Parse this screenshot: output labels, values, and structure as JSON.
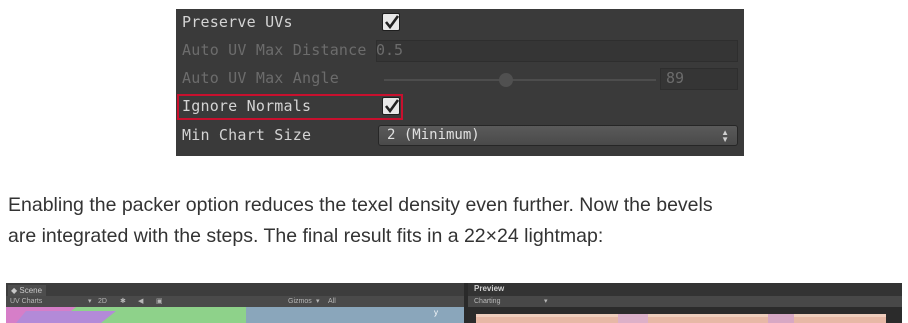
{
  "inspector": {
    "preserve_uvs": {
      "label": "Preserve UVs",
      "checked": true
    },
    "auto_uv_max_distance": {
      "label": "Auto UV Max Distance",
      "value": "0.5"
    },
    "auto_uv_max_angle": {
      "label": "Auto UV Max Angle",
      "value": "89",
      "slider_fraction": 0.45
    },
    "ignore_normals": {
      "label": "Ignore Normals",
      "checked": true
    },
    "min_chart_size": {
      "label": "Min Chart Size",
      "value": "2 (Minimum)"
    },
    "colors": {
      "panel": "#3a3a3a",
      "highlight": "#c8102e",
      "label": "#d4d4d4",
      "disabled": "#6c6c6c"
    }
  },
  "article": {
    "line1": "Enabling the packer option reduces the texel density even further. Now the bevels",
    "line2": "are integrated with the steps. The final result fits in a 22×24 lightmap:"
  },
  "editor_strip": {
    "scene_tab": "Scene",
    "scene_mode": "UV Charts",
    "mode_2d": "2D",
    "gizmos": "Gizmos",
    "search": "All",
    "axis_label": "y",
    "preview_tab": "Preview",
    "preview_mode": "Charting"
  }
}
